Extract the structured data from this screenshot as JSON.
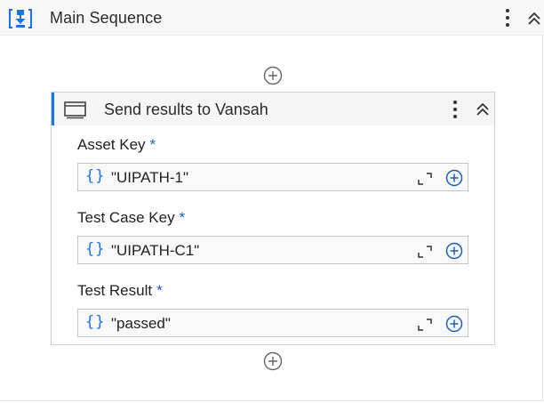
{
  "main_sequence": {
    "title": "Main Sequence",
    "icon": "sequence-icon"
  },
  "activity": {
    "title": "Send results to Vansah",
    "icon": "window-icon",
    "accent_color": "#1a73e8",
    "fields": [
      {
        "label": "Asset Key",
        "required_mark": "*",
        "value": "\"UIPATH-1\"",
        "expression_icon": "{}"
      },
      {
        "label": "Test Case Key",
        "required_mark": "*",
        "value": "\"UIPATH-C1\"",
        "expression_icon": "{}"
      },
      {
        "label": "Test Result",
        "required_mark": "*",
        "value": "\"passed\"",
        "expression_icon": "{}"
      }
    ]
  },
  "colors": {
    "accent": "#1a73e8",
    "required": "#1a5fb4",
    "header_bg": "#f7f7f7"
  }
}
